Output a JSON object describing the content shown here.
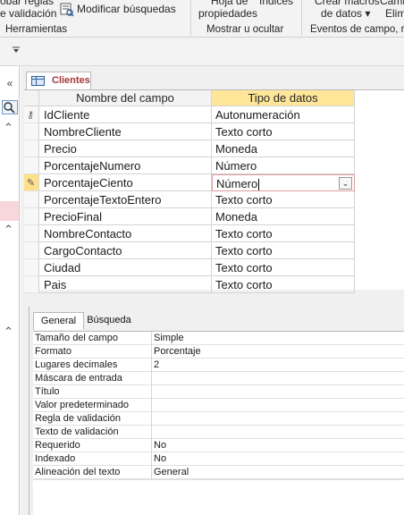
{
  "ribbon": {
    "top_left_line1": "obar reglas",
    "top_left_line2": "e validación",
    "modify_lookups_label": "Modificar búsquedas",
    "sheet_line1": "Hoja de",
    "indices_label": "Índices",
    "properties_label": "propiedades",
    "create_macros_label": "Crear macros",
    "rename_label": "Camb",
    "data_label": "de datos ▾",
    "delete_label": "Elimi",
    "groups": {
      "tools": "Herramientas",
      "show_hide": "Mostrar u ocultar",
      "events": "Eventos de campo, r"
    }
  },
  "qat": {
    "dropdown_icon": "customize-qat-icon"
  },
  "nav": {
    "collapse_icon": "double-chevron-left-icon",
    "search_icon": "search-icon",
    "section_icon": "double-chevron-up-icon"
  },
  "document_tab": {
    "label": "Clientes",
    "icon": "table-icon"
  },
  "grid": {
    "header_name": "Nombre del campo",
    "header_type": "Tipo de datos",
    "rows": [
      {
        "name": "IdCliente",
        "type": "Autonumeración",
        "primary_key": true
      },
      {
        "name": "NombreCliente",
        "type": "Texto corto"
      },
      {
        "name": "Precio",
        "type": "Moneda"
      },
      {
        "name": "PorcentajeNumero",
        "type": "Número"
      },
      {
        "name": "PorcentajeCiento",
        "type": "Número",
        "current": true
      },
      {
        "name": "PorcentajeTextoEntero",
        "type": "Texto corto"
      },
      {
        "name": "PrecioFinal",
        "type": "Moneda"
      },
      {
        "name": "NombreContacto",
        "type": "Texto corto"
      },
      {
        "name": "CargoContacto",
        "type": "Texto corto"
      },
      {
        "name": "Ciudad",
        "type": "Texto corto"
      },
      {
        "name": "Pais",
        "type": "Texto corto"
      }
    ]
  },
  "properties": {
    "tab_general": "General",
    "tab_lookup": "Búsqueda",
    "rows": [
      {
        "label": "Tamaño del campo",
        "value": "Simple"
      },
      {
        "label": "Formato",
        "value": "Porcentaje"
      },
      {
        "label": "Lugares decimales",
        "value": "2"
      },
      {
        "label": "Máscara de entrada",
        "value": ""
      },
      {
        "label": "Título",
        "value": ""
      },
      {
        "label": "Valor predeterminado",
        "value": ""
      },
      {
        "label": "Regla de validación",
        "value": ""
      },
      {
        "label": "Texto de validación",
        "value": ""
      },
      {
        "label": "Requerido",
        "value": "No"
      },
      {
        "label": "Indexado",
        "value": "No"
      },
      {
        "label": "Alineación del texto",
        "value": "General"
      }
    ]
  },
  "colors": {
    "type_header_bg": "#ffe699",
    "tab_label": "#a4373a",
    "current_row_selector": "#ffe08a",
    "active_cell_border": "#e09aa0"
  }
}
